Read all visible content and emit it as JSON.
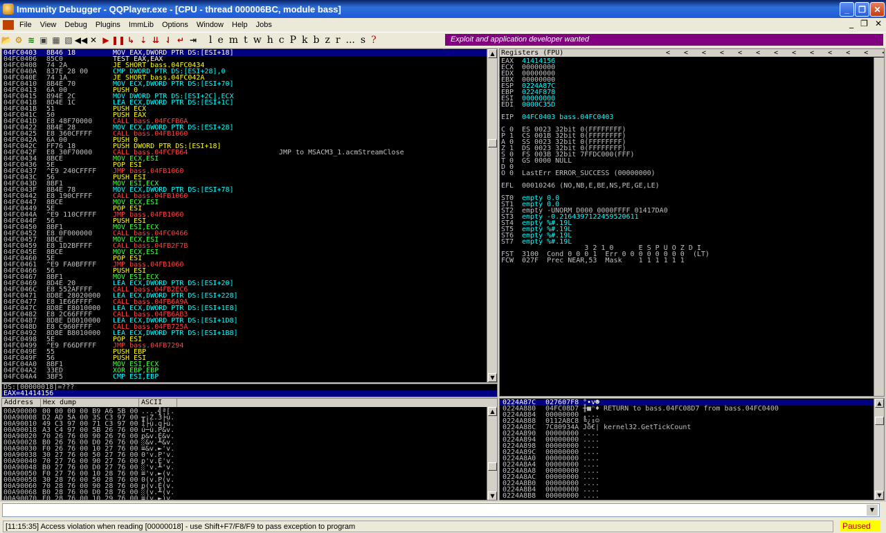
{
  "window": {
    "title": "Immunity Debugger - QQPlayer.exe - [CPU - thread 000006BC, module bass]"
  },
  "menu": [
    "File",
    "View",
    "Debug",
    "Plugins",
    "ImmLib",
    "Options",
    "Window",
    "Help",
    "Jobs"
  ],
  "toolbar": {
    "letters": [
      "l",
      "e",
      "m",
      "t",
      "w",
      "h",
      "c",
      "P",
      "k",
      "b",
      "z",
      "r",
      "...",
      "s",
      "?"
    ],
    "banner": "Exploit and application developer wanted"
  },
  "disasm": [
    [
      "04FC0403",
      "8B46 18",
      "MOV EAX,DWORD PTR DS:[ESI+18]",
      "",
      ""
    ],
    [
      "04FC0406",
      "85C0",
      "TEST EAX,EAX",
      "",
      "w"
    ],
    [
      "04FC0408",
      "74 2A",
      "JE SHORT bass.04FC0434",
      "",
      "y"
    ],
    [
      "04FC040A",
      "837E 28 00",
      "CMP DWORD PTR DS:[ESI+28],0",
      "",
      "cy"
    ],
    [
      "04FC040E",
      "74 1A",
      "JE SHORT bass.04FC042A",
      "",
      "y"
    ],
    [
      "04FC0410",
      "8B4E 70",
      "MOV ECX,DWORD PTR DS:[ESI+70]",
      "",
      "cy"
    ],
    [
      "04FC0413",
      "6A 00",
      "PUSH 0",
      "",
      "y"
    ],
    [
      "04FC0415",
      "894E 2C",
      "MOV DWORD PTR DS:[ESI+2C],ECX",
      "",
      "cy"
    ],
    [
      "04FC0418",
      "8D4E 1C",
      "LEA ECX,DWORD PTR DS:[ESI+1C]",
      "",
      "cy"
    ],
    [
      "04FC041B",
      "51",
      "PUSH ECX",
      "",
      "y"
    ],
    [
      "04FC041C",
      "50",
      "PUSH EAX",
      "",
      "y"
    ],
    [
      "04FC041D",
      "E8 48F70000",
      "CALL bass.04FCFB6A",
      "",
      "r"
    ],
    [
      "04FC0422",
      "8B4E 28",
      "MOV ECX,DWORD PTR DS:[ESI+28]",
      "",
      "cy"
    ],
    [
      "04FC0425",
      "E8 360CFFFF",
      "CALL bass.04FB1060",
      "",
      "r"
    ],
    [
      "04FC042A",
      "6A 00",
      "PUSH 0",
      "",
      "y"
    ],
    [
      "04FC042C",
      "FF76 18",
      "PUSH DWORD PTR DS:[ESI+18]",
      "",
      "y"
    ],
    [
      "04FC042F",
      "E8 30F70000",
      "CALL bass.04FCFB64",
      "JMP to MSACM3_1.acmStreamClose",
      "r"
    ],
    [
      "04FC0434",
      "8BCE",
      "MOV ECX,ESI",
      "",
      "g"
    ],
    [
      "04FC0436",
      "5E",
      "POP ESI",
      "",
      "y"
    ],
    [
      "04FC0437",
      "^E9 240CFFFF",
      "JMP bass.04FB1060",
      "",
      "r"
    ],
    [
      "04FC043C",
      "56",
      "PUSH ESI",
      "",
      "y"
    ],
    [
      "04FC043D",
      "8BF1",
      "MOV ESI,ECX",
      "",
      "g"
    ],
    [
      "04FC043F",
      "8B4E 78",
      "MOV ECX,DWORD PTR DS:[ESI+78]",
      "",
      "cy"
    ],
    [
      "04FC0442",
      "E8 190CFFFF",
      "CALL bass.04FB1060",
      "",
      "r"
    ],
    [
      "04FC0447",
      "8BCE",
      "MOV ECX,ESI",
      "",
      "g"
    ],
    [
      "04FC0449",
      "5E",
      "POP ESI",
      "",
      "y"
    ],
    [
      "04FC044A",
      "^E9 110CFFFF",
      "JMP bass.04FB1060",
      "",
      "r"
    ],
    [
      "04FC044F",
      "56",
      "PUSH ESI",
      "",
      "y"
    ],
    [
      "04FC0450",
      "8BF1",
      "MOV ESI,ECX",
      "",
      "g"
    ],
    [
      "04FC0452",
      "E8 0F000000",
      "CALL bass.04FC0466",
      "",
      "r"
    ],
    [
      "04FC0457",
      "8BCE",
      "MOV ECX,ESI",
      "",
      "g"
    ],
    [
      "04FC0459",
      "E8 1D2BFFFF",
      "CALL bass.04FB2F7B",
      "",
      "r"
    ],
    [
      "04FC045E",
      "8BCE",
      "MOV ECX,ESI",
      "",
      "g"
    ],
    [
      "04FC0460",
      "5E",
      "POP ESI",
      "",
      "y"
    ],
    [
      "04FC0461",
      "^E9 FA0BFFFF",
      "JMP bass.04FB1060",
      "",
      "r"
    ],
    [
      "04FC0466",
      "56",
      "PUSH ESI",
      "",
      "y"
    ],
    [
      "04FC0467",
      "8BF1",
      "MOV ESI,ECX",
      "",
      "g"
    ],
    [
      "04FC0469",
      "8D4E 20",
      "LEA ECX,DWORD PTR DS:[ESI+20]",
      "",
      "cy"
    ],
    [
      "04FC046C",
      "E8 552AFFFF",
      "CALL bass.04FB2EC6",
      "",
      "r"
    ],
    [
      "04FC0471",
      "8D8E 28020000",
      "LEA ECX,DWORD PTR DS:[ESI+228]",
      "",
      "cy"
    ],
    [
      "04FC0477",
      "E8 1E66FFFF",
      "CALL bass.04FB6A9A",
      "",
      "r"
    ],
    [
      "04FC047C",
      "8D8E E8010000",
      "LEA ECX,DWORD PTR DS:[ESI+1E8]",
      "",
      "cy"
    ],
    [
      "04FC0482",
      "E8 2C66FFFF",
      "CALL bass.04FB6AB3",
      "",
      "r"
    ],
    [
      "04FC0487",
      "8D8E D8010000",
      "LEA ECX,DWORD PTR DS:[ESI+1D8]",
      "",
      "cy"
    ],
    [
      "04FC048D",
      "E8 C960FFFF",
      "CALL bass.04FB725A",
      "",
      "r"
    ],
    [
      "04FC0492",
      "8D8E B8010000",
      "LEA ECX,DWORD PTR DS:[ESI+1B8]",
      "",
      "cy"
    ],
    [
      "04FC0498",
      "5E",
      "POP ESI",
      "",
      "y"
    ],
    [
      "04FC0499",
      "^E9 F66DFFFF",
      "JMP bass.04FB7294",
      "",
      "r"
    ],
    [
      "04FC049E",
      "55",
      "PUSH EBP",
      "",
      "y"
    ],
    [
      "04FC049F",
      "56",
      "PUSH ESI",
      "",
      "y"
    ],
    [
      "04FC04A0",
      "8BF1",
      "MOV ESI,ECX",
      "",
      "g"
    ],
    [
      "04FC04A2",
      "33ED",
      "XOR EBP,EBP",
      "",
      "g"
    ],
    [
      "04FC04A4",
      "3BF5",
      "CMP ESI,EBP",
      "",
      "cy"
    ]
  ],
  "info": {
    "line1": "DS:[00000018]=???",
    "line2": "EAX=41414156"
  },
  "registers": {
    "header": "Registers (FPU)",
    "lines": [
      [
        "EAX",
        "41414156",
        "cy"
      ],
      [
        "ECX",
        "00000000",
        "gr"
      ],
      [
        "EDX",
        "00000000",
        "gr"
      ],
      [
        "EBX",
        "00000000",
        "gr"
      ],
      [
        "ESP",
        "0224A87C",
        "cy"
      ],
      [
        "EBP",
        "0224F878",
        "cy"
      ],
      [
        "ESI",
        "00000000",
        "cy"
      ],
      [
        "EDI",
        "0000C35D",
        "cy"
      ],
      [
        "",
        "",
        ""
      ],
      [
        "EIP",
        "04FC0403 bass.04FC0403",
        "cy"
      ],
      [
        "",
        "",
        ""
      ],
      [
        "C 0",
        "ES 0023 32bit 0(FFFFFFFF)",
        "gr"
      ],
      [
        "P 1",
        "CS 001B 32bit 0(FFFFFFFF)",
        "gr"
      ],
      [
        "A 0",
        "SS 0023 32bit 0(FFFFFFFF)",
        "gr"
      ],
      [
        "Z 1",
        "DS 0023 32bit 0(FFFFFFFF)",
        "gr"
      ],
      [
        "S 0",
        "FS 003B 32bit 7FFDC000(FFF)",
        "gr"
      ],
      [
        "T 0",
        "GS 0000 NULL",
        "gr"
      ],
      [
        "D 0",
        "",
        "gr"
      ],
      [
        "O 0",
        "LastErr ERROR_SUCCESS (00000000)",
        "gr"
      ],
      [
        "",
        "",
        ""
      ],
      [
        "EFL",
        "00010246 (NO,NB,E,BE,NS,PE,GE,LE)",
        "gr"
      ],
      [
        "",
        "",
        ""
      ],
      [
        "ST0",
        "empty 0.0",
        "cy"
      ],
      [
        "ST1",
        "empty 0.0",
        "cy"
      ],
      [
        "ST2",
        "empty -UNORM D000 0000FFFF 01417DA0",
        "gr"
      ],
      [
        "ST3",
        "empty -0.2164397122459520611",
        "cy"
      ],
      [
        "ST4",
        "empty %#.19L",
        "cy"
      ],
      [
        "ST5",
        "empty %#.19L",
        "cy"
      ],
      [
        "ST6",
        "empty %#.19L",
        "cy"
      ],
      [
        "ST7",
        "empty %#.19L",
        "cy"
      ],
      [
        "",
        "               3 2 1 0      E S P U O Z D I",
        "gr"
      ],
      [
        "FST",
        "3100  Cond 0 0 0 1  Err 0 0 0 0 0 0 0 0  (LT)",
        "gr"
      ],
      [
        "FCW",
        "027F  Prec NEAR,53  Mask    1 1 1 1 1 1",
        "gr"
      ]
    ]
  },
  "dump": {
    "headers": [
      "Address",
      "Hex dump",
      "ASCII"
    ],
    "rows": [
      [
        "00A90000",
        "00 00 00 00 B9 A6 5B 00",
        "....╣ª[."
      ],
      [
        "00A90008",
        "D2 AD 5A 00 3S C3 97 00",
        "╥¡Z.3├ù."
      ],
      [
        "00A90010",
        "49 C3 97 00 71 C3 97 00",
        "I├ù.q├ù."
      ],
      [
        "00A90018",
        "A3 C4 97 00 5B 26 76 00",
        "ú─ù.P&v."
      ],
      [
        "00A90020",
        "70 26 76 00 90 26 76 00",
        "p&v.É&v."
      ],
      [
        "00A90028",
        "B0 26 76 00 D0 26 76 00",
        "░&v.╨&v."
      ],
      [
        "00A90030",
        "F0 26 76 00 10 27 76 00",
        "≡&v.►'v."
      ],
      [
        "00A90038",
        "30 27 76 00 50 27 76 00",
        "0'v.P'v."
      ],
      [
        "00A90040",
        "70 27 76 00 90 27 76 00",
        "p'v.É'v."
      ],
      [
        "00A90048",
        "B0 27 76 00 D0 27 76 00",
        "░'v.╨'v."
      ],
      [
        "00A90050",
        "F0 27 76 00 10 28 76 00",
        "≡'v.►(v."
      ],
      [
        "00A90058",
        "30 28 76 00 50 28 76 00",
        "0(v.P(v."
      ],
      [
        "00A90060",
        "70 28 76 00 90 28 76 00",
        "p(v.É(v."
      ],
      [
        "00A90068",
        "B0 28 76 00 D0 28 76 00",
        "░(v.╨(v."
      ],
      [
        "00A90070",
        "F0 28 76 00 10 29 76 00",
        "≡(v.►)v."
      ]
    ]
  },
  "stack": [
    [
      "0224A87C",
      "027607F8",
      "°•v☻",
      "",
      1
    ],
    [
      "0224A880",
      "04FC08D7",
      "╫■ⁿ♦",
      "RETURN to bass.04FC08D7 from bass.04FC0400",
      0
    ],
    [
      "0224A884",
      "00000000",
      "....",
      "",
      0
    ],
    [
      "0224A888",
      "0112A8C8",
      "╚¿↕☺",
      "",
      0
    ],
    [
      "0224A88C",
      "7C80934A",
      "Jô€|",
      "kernel32.GetTickCount",
      0
    ],
    [
      "0224A890",
      "00000000",
      "....",
      "",
      0
    ],
    [
      "0224A894",
      "00000000",
      "....",
      "",
      0
    ],
    [
      "0224A898",
      "00000000",
      "....",
      "",
      0
    ],
    [
      "0224A89C",
      "00000000",
      "....",
      "",
      0
    ],
    [
      "0224A8A0",
      "00000000",
      "....",
      "",
      0
    ],
    [
      "0224A8A4",
      "00000000",
      "....",
      "",
      0
    ],
    [
      "0224A8A8",
      "00000000",
      "....",
      "",
      0
    ],
    [
      "0224A8AC",
      "00000000",
      "....",
      "",
      0
    ],
    [
      "0224A8B0",
      "00000000",
      "....",
      "",
      0
    ],
    [
      "0224A8B4",
      "00000000",
      "....",
      "",
      0
    ],
    [
      "0224A8B8",
      "00000000",
      "....",
      "",
      0
    ]
  ],
  "status": {
    "message": "[11:15:35] Access violation when reading [00000018] - use Shift+F7/F8/F9 to pass exception to program",
    "state": "Paused"
  },
  "colors": {
    "title": "#0a246a",
    "banner": "#800080",
    "selection": "#000080",
    "paused": "#ffff00"
  }
}
